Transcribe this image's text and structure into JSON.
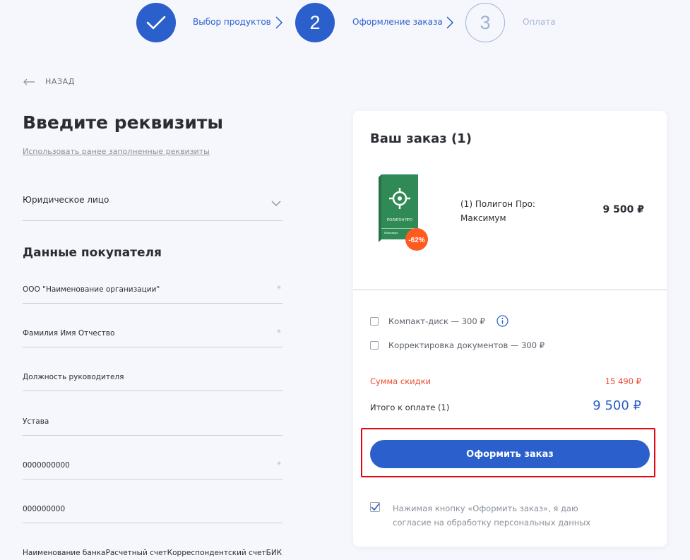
{
  "steps": [
    {
      "label": "Выбор продуктов",
      "state": "done"
    },
    {
      "number": "2",
      "label": "Оформление заказа",
      "state": "active"
    },
    {
      "number": "3",
      "label": "Оплата",
      "state": "pending"
    }
  ],
  "back": {
    "label": "НАЗАД"
  },
  "form": {
    "title": "Введите реквизиты",
    "prev_link": "Использовать ранее заполненные реквизиты",
    "entity_select": {
      "value": "Юридическое лицо"
    },
    "section_title": "Данные покупателя",
    "fields": [
      {
        "label": "ООО \"Наименование организации\"",
        "required": "*"
      },
      {
        "label": "Фамилия Имя Отчество",
        "required": "*"
      },
      {
        "label": "Должность руководителя",
        "required": ""
      },
      {
        "label": "Устава",
        "required": ""
      },
      {
        "label": "0000000000",
        "required": "*"
      },
      {
        "label": "000000000",
        "required": ""
      },
      {
        "label": "Наименование банкаРасчетный счетКорреспондентский счетБИК",
        "required": ""
      }
    ]
  },
  "order": {
    "title": "Ваш заказ (1)",
    "product": {
      "name": "(1) Полигон Про: Максимум",
      "price": "9 500 ₽",
      "discount_badge": "-62%",
      "box_title": "ПОЛИГОН ПРО",
      "box_subtitle": "Максимум"
    },
    "options": [
      {
        "label": "Компакт-диск — 300 ₽",
        "checked": false
      },
      {
        "label": "Корректировка документов — 300 ₽",
        "checked": false
      }
    ],
    "discount_label": "Сумма скидки",
    "discount_value": "15 490 ₽",
    "total_label": "Итого к оплате (1)",
    "total_value": "9 500 ₽",
    "submit_label": "Оформить заказ",
    "consent_text": "Нажимая кнопку «Оформить заказ», я даю согласие на обработку персональных данных",
    "consent_checked": true
  },
  "colors": {
    "accent": "#2b5fcc",
    "discount": "#ef4a2b",
    "badge": "#ff5a1f",
    "product_box": "#2f8a55",
    "highlight": "#e30613"
  }
}
